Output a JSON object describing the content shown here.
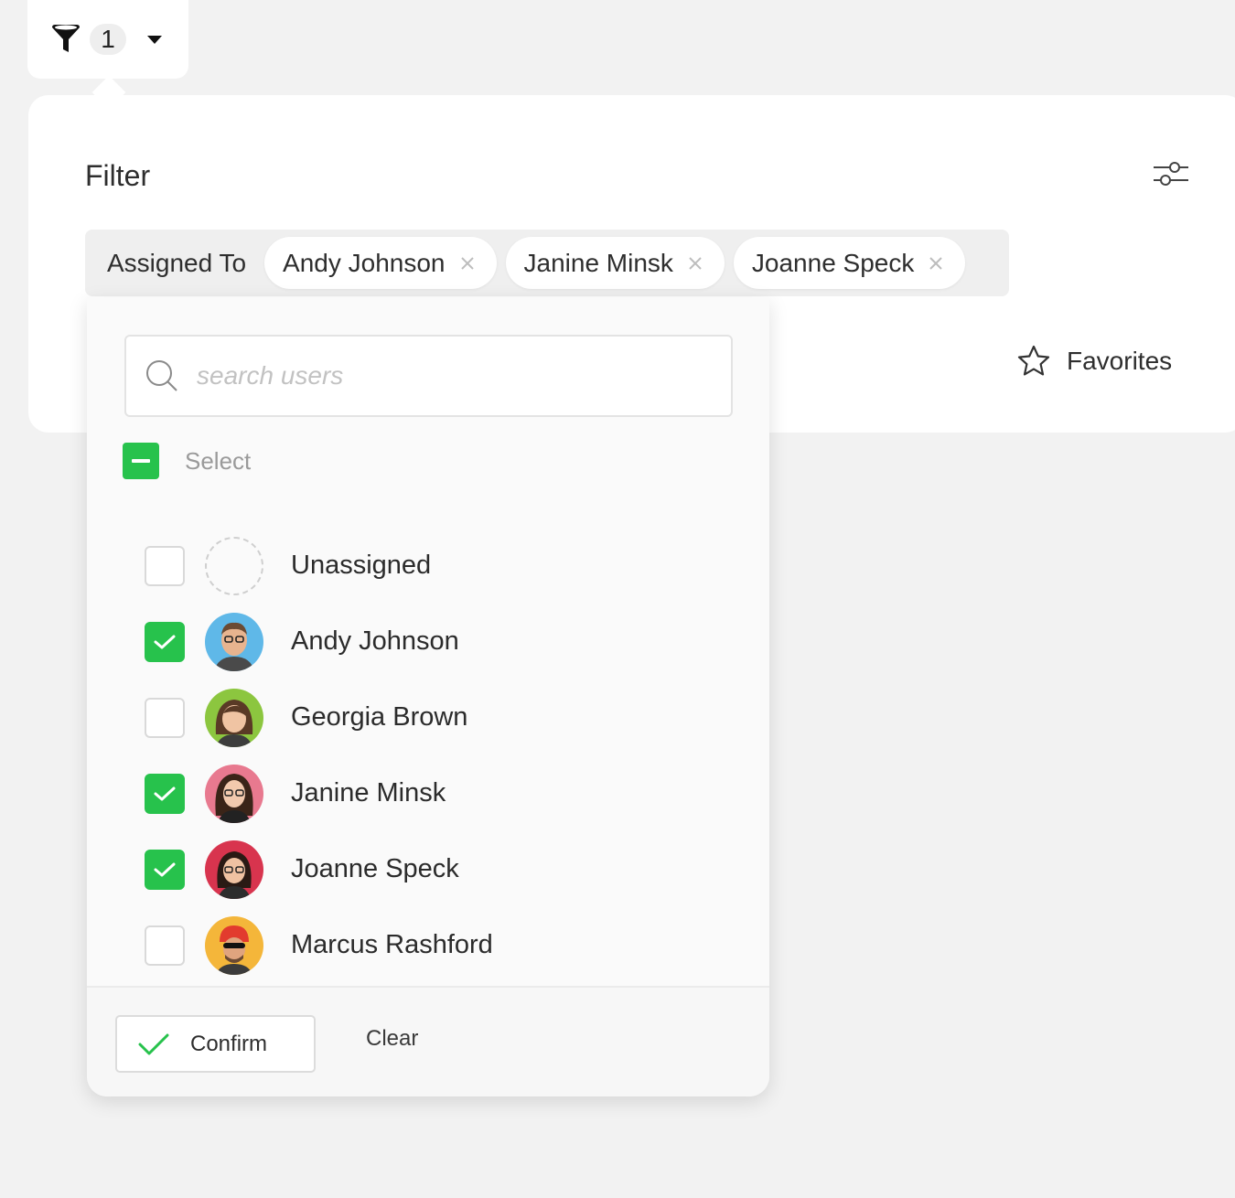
{
  "filter_trigger": {
    "count": "1"
  },
  "filter_panel": {
    "title": "Filter",
    "assigned_label": "Assigned To",
    "chips": [
      {
        "label": "Andy Johnson"
      },
      {
        "label": "Janine Minsk"
      },
      {
        "label": "Joanne Speck"
      }
    ],
    "favorites_label": "Favorites"
  },
  "dropdown": {
    "search_placeholder": "search users",
    "select_all_label": "Select",
    "users": [
      {
        "name": "Unassigned",
        "checked": false,
        "avatar": "empty"
      },
      {
        "name": "Andy Johnson",
        "checked": true,
        "avatar": "blue"
      },
      {
        "name": "Georgia Brown",
        "checked": false,
        "avatar": "green"
      },
      {
        "name": "Janine Minsk",
        "checked": true,
        "avatar": "pink"
      },
      {
        "name": "Joanne Speck",
        "checked": true,
        "avatar": "red"
      },
      {
        "name": "Marcus Rashford",
        "checked": false,
        "avatar": "orange"
      }
    ],
    "confirm_label": "Confirm",
    "clear_label": "Clear"
  },
  "colors": {
    "accent_green": "#27c24c",
    "avatar_blue": "#5fb8e8",
    "avatar_green": "#8cc63f",
    "avatar_pink": "#e8798f",
    "avatar_red": "#d8344e",
    "avatar_orange": "#f4b63a"
  }
}
